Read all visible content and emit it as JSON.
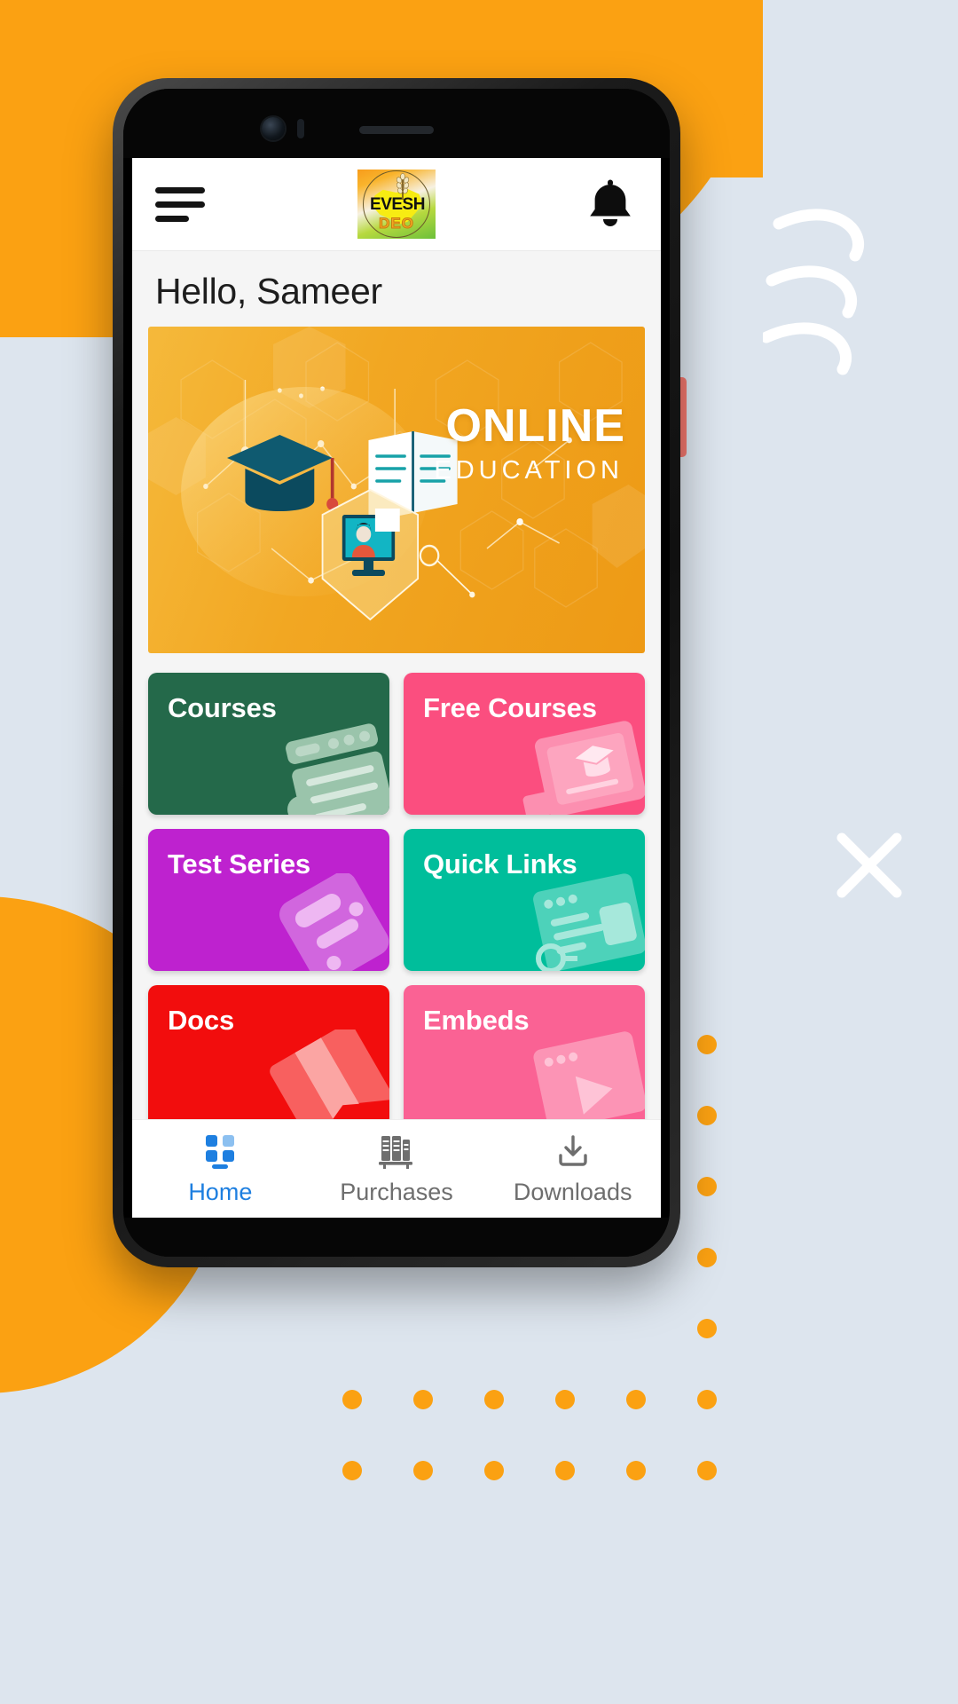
{
  "app": {
    "logo_text": "EVESH",
    "logo_sub": "DEO",
    "logo_name": "devesh-deo-logo"
  },
  "header": {
    "menu_icon": "hamburger-menu-icon",
    "notification_icon": "bell-icon"
  },
  "greeting": {
    "text": "Hello, Sameer"
  },
  "banner": {
    "title": "ONLINE",
    "subtitle": "EDUCATION",
    "alt": "online-education-banner"
  },
  "tiles": [
    {
      "label": "Courses",
      "color": "#24694A",
      "art": "#9AC4AB",
      "icon": "browser-document-icon"
    },
    {
      "label": "Free Courses",
      "color": "#FB4E7F",
      "art": "#FC8FB0",
      "icon": "certificate-icon"
    },
    {
      "label": "Test Series",
      "color": "#BE22CF",
      "art": "#D166DE",
      "icon": "cards-icon"
    },
    {
      "label": "Quick Links",
      "color": "#00BE9B",
      "art": "#4DD2BA",
      "icon": "link-window-icon"
    },
    {
      "label": "Docs",
      "color": "#F20D0D",
      "art": "#F8605F",
      "icon": "bookmark-icon"
    },
    {
      "label": "Embeds",
      "color": "#FA6294",
      "art": "#FC94B5",
      "icon": "video-embed-icon"
    }
  ],
  "bottom_nav": {
    "items": [
      {
        "label": "Home",
        "icon": "grid-dashboard-icon",
        "active": true
      },
      {
        "label": "Purchases",
        "icon": "books-shelf-icon",
        "active": false
      },
      {
        "label": "Downloads",
        "icon": "download-icon",
        "active": false
      }
    ],
    "active_color": "#1E7FE0",
    "inactive_color": "#6E6E6E"
  },
  "background": {
    "accent_color": "#FBA112",
    "page_color": "#DDE5EE",
    "xmark_icon": "x-mark-decoration",
    "wave_icon": "wave-decoration"
  }
}
